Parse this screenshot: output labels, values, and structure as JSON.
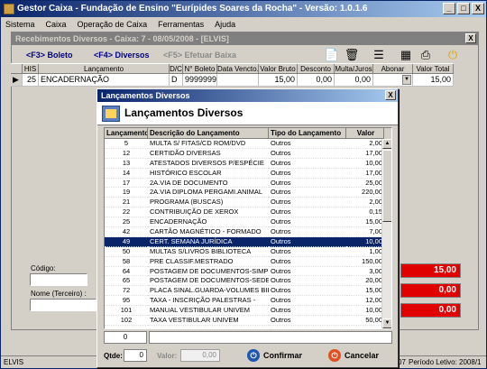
{
  "window": {
    "title": "Gestor Caixa - Fundação de Ensino \"Eurípides Soares da Rocha\" - Versão: 1.0.1.6",
    "buttons": [
      "_",
      "□",
      "X"
    ]
  },
  "menu": [
    "Sistema",
    "Caixa",
    "Operação de Caixa",
    "Ferramentas",
    "Ajuda"
  ],
  "child_window": {
    "title": "Recebimentos Diversos - Caixa: 7 - 08/05/2008 - [ELVIS]",
    "close": "X",
    "toolbar": {
      "boleto": "<F3> Boleto",
      "diversos": "<F4> Diversos",
      "efetuar_baixa": "<F5> Efetuar Baixa"
    },
    "grid": {
      "headers": [
        "HIS",
        "Lançamento",
        "D/C",
        "N° Boleto",
        "Data Vencto.",
        "Valor Bruto",
        "Desconto",
        "Multa/Juros",
        "Abonar",
        "Valor Total"
      ],
      "row": [
        "25",
        "ENCADERNAÇÃO",
        "D",
        "9999999",
        "",
        "15,00",
        "0,00",
        "0,00",
        "",
        "15,00"
      ]
    },
    "form": {
      "codigo_label": "Código:",
      "nome_label": "Nome (Terceiro) :"
    },
    "totals": [
      "15,00",
      "0,00",
      "0,00"
    ]
  },
  "statusbar": {
    "user": "ELVIS",
    "right_prefix": "07",
    "periodo": "Período Letivo: 2008/1"
  },
  "dialog": {
    "title": "Lançamentos Diversos",
    "close": "X",
    "header_title": "Lançamentos Diversos",
    "columns": [
      "Lançamento",
      "Descrição do Lançamento",
      "Tipo do Lançamento",
      "Valor"
    ],
    "rows": [
      [
        "5",
        "MULTA S/ FITAS/CD ROM/DVD",
        "Outros",
        "2,00"
      ],
      [
        "12",
        "CERTIDÃO DIVERSAS",
        "Outros",
        "17,00"
      ],
      [
        "13",
        "ATESTADOS DIVERSOS P/ESPÉCIE",
        "Outros",
        "10,00"
      ],
      [
        "14",
        "HISTÓRICO ESCOLAR",
        "Outros",
        "17,00"
      ],
      [
        "17",
        "2A.VIA DE DOCUMENTO",
        "Outros",
        "25,00"
      ],
      [
        "19",
        "2A.VIA DIPLOMA PERGAMI.ANIMAL",
        "Outros",
        "220,00"
      ],
      [
        "21",
        "PROGRAMA (BUSCAS)",
        "Outros",
        "2,00"
      ],
      [
        "22",
        "CONTRIBUIÇÃO DE XEROX",
        "Outros",
        "0,15"
      ],
      [
        "25",
        "ENCADERNAÇÃO",
        "Outros",
        "15,00"
      ],
      [
        "42",
        "CARTÃO MAGNÉTICO - FORMADO",
        "Outros",
        "7,00"
      ],
      [
        "49",
        "CERT. SEMANA JURÍDICA",
        "Outros",
        "10,00"
      ],
      [
        "50",
        "MULTAS S/LIVROS BIBLIOTECA",
        "Outros",
        "1,00"
      ],
      [
        "58",
        "PRE CLASSIF.MESTRADO",
        "Outros",
        "150,00"
      ],
      [
        "64",
        "POSTAGEM DE DOCUMENTOS-SIMPLES",
        "Outros",
        "3,00"
      ],
      [
        "65",
        "POSTAGEM DE DOCUMENTOS-SEDEX",
        "Outros",
        "20,00"
      ],
      [
        "72",
        "PLACA SINAL.GUARDA-VOLUMES BIB",
        "Outros",
        "15,00"
      ],
      [
        "95",
        "TAXA - INSCRIÇÃO PALESTRAS -",
        "Outros",
        "12,00"
      ],
      [
        "101",
        "MANUAL VESTIBULAR UNIVEM",
        "Outros",
        "10,00"
      ],
      [
        "102",
        "TAXA VESTIBULAR UNIVEM",
        "Outros",
        "50,00"
      ]
    ],
    "selected_index": 10,
    "search_code": "0",
    "qtde_label": "Qtde:",
    "qtde_value": "0",
    "valor_label": "Valor:",
    "valor_value": "0,00",
    "confirm": "Confirmar",
    "cancel": "Cancelar"
  },
  "colors": {
    "title_gradient_start": "#0a246a",
    "selection": "#0a246a",
    "total_field": "#e00000"
  }
}
